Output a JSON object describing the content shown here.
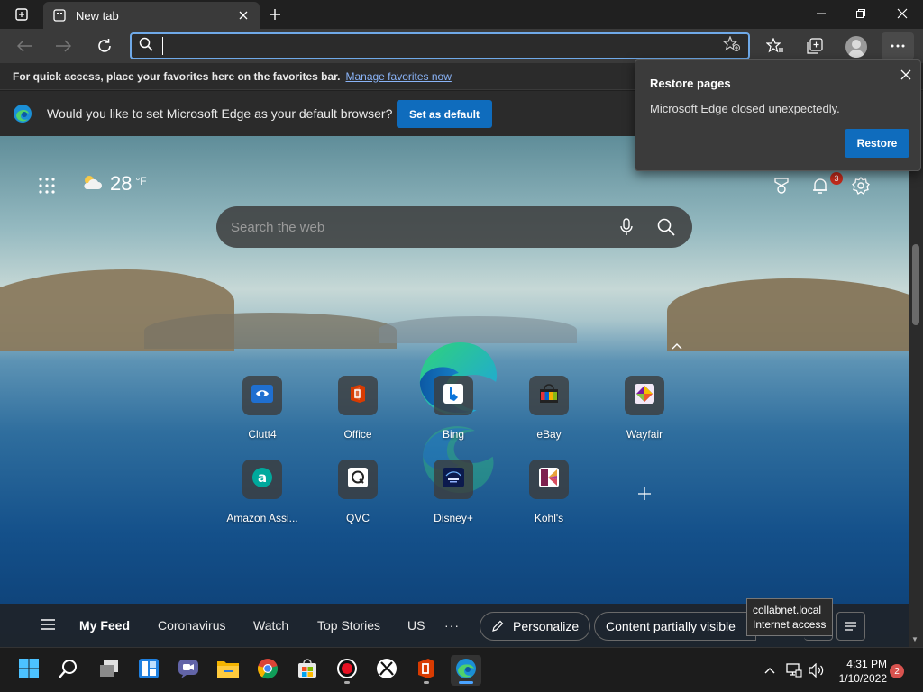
{
  "browser": {
    "tab_title": "New tab",
    "address_value": "",
    "favorites_bar": {
      "message": "For quick access, place your favorites here on the favorites bar.",
      "link": "Manage favorites now"
    },
    "default_infobar": {
      "message": "Would you like to set Microsoft Edge as your default browser?",
      "button": "Set as default"
    },
    "restore_popup": {
      "title": "Restore pages",
      "message": "Microsoft Edge closed unexpectedly.",
      "button": "Restore"
    }
  },
  "newtab": {
    "weather": {
      "temp": "28",
      "unit": "°F"
    },
    "notifications_count": "3",
    "search_placeholder": "Search the web",
    "tiles": [
      {
        "label": "Clutt4",
        "icon": "clutt4-icon",
        "color": "#1f6fd0"
      },
      {
        "label": "Office",
        "icon": "office-icon",
        "color": "#d83b01"
      },
      {
        "label": "Bing",
        "icon": "bing-icon",
        "color": "#ffffff"
      },
      {
        "label": "eBay",
        "icon": "ebay-icon",
        "color": "#e53238"
      },
      {
        "label": "Wayfair",
        "icon": "wayfair-icon",
        "color": "#7b189f"
      },
      {
        "label": "Amazon Assi...",
        "icon": "amazon-assistant-icon",
        "color": "#00a99d"
      },
      {
        "label": "QVC",
        "icon": "qvc-icon",
        "color": "#ffffff"
      },
      {
        "label": "Disney+",
        "icon": "disney-plus-icon",
        "color": "#0b1a4d"
      },
      {
        "label": "Kohl's",
        "icon": "kohls-icon",
        "color": "#7d1f4e"
      }
    ],
    "feed": {
      "items": [
        "My Feed",
        "Coronavirus",
        "Watch",
        "Top Stories",
        "US"
      ],
      "more": "···",
      "personalize": "Personalize",
      "content_visibility": "Content partially visible"
    }
  },
  "tooltip": {
    "line1": "collabnet.local",
    "line2": "Internet access"
  },
  "taskbar": {
    "time": "4:31 PM",
    "date": "1/10/2022",
    "notification_badge": "2"
  },
  "colors": {
    "accent": "#0f6cbd",
    "address_focus": "#6fa9e8",
    "badge": "#c42b1c"
  }
}
